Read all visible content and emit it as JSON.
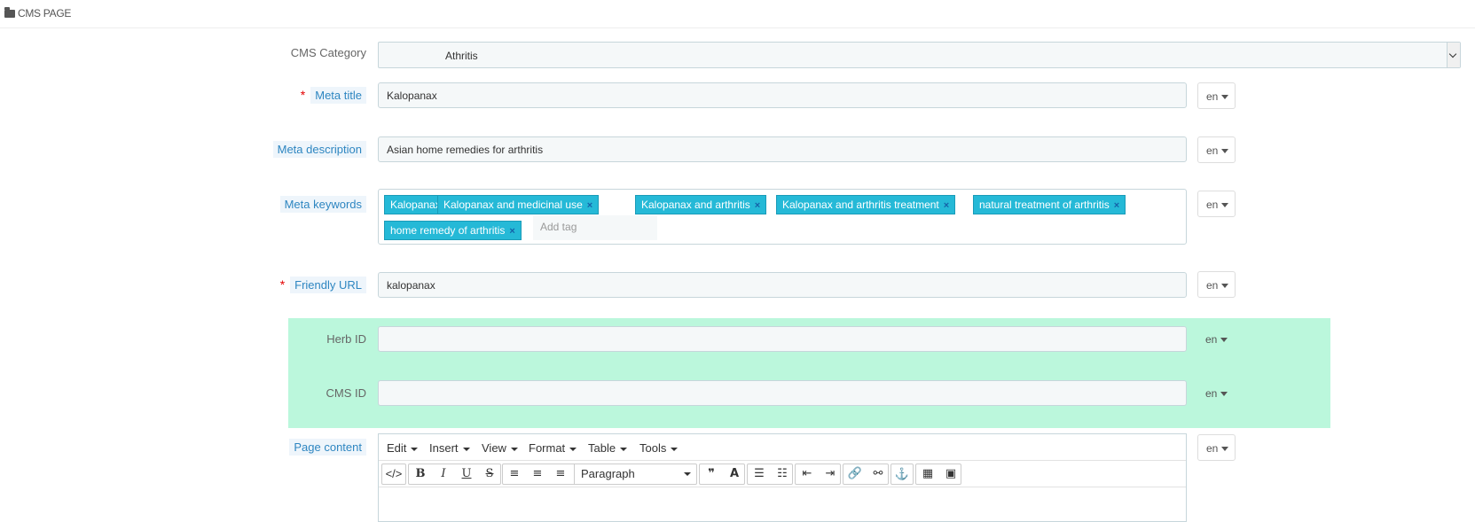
{
  "header": {
    "title": "CMS PAGE",
    "icon": "folder-icon"
  },
  "fields": {
    "cms_category": {
      "label": "CMS Category",
      "value": "Athritis"
    },
    "meta_title": {
      "label": "Meta title",
      "value": "Kalopanax",
      "lang": "en"
    },
    "meta_description": {
      "label": "Meta description",
      "value": "Asian home remedies for arthritis",
      "lang": "en"
    },
    "meta_keywords": {
      "label": "Meta keywords",
      "lang": "en",
      "tags": [
        "Kalopanax",
        "Kalopanax and medicinal use",
        "Kalopanax and arthritis",
        "Kalopanax and arthritis treatment",
        "natural treatment of arthritis",
        "home remedy of arthritis"
      ],
      "tag_remove": "×",
      "add_tag_placeholder": "Add tag"
    },
    "friendly_url": {
      "label": "Friendly URL",
      "value": "kalopanax",
      "lang": "en"
    },
    "herb_id": {
      "label": "Herb ID",
      "value": "",
      "lang": "en"
    },
    "cms_id": {
      "label": "CMS ID",
      "value": "",
      "lang": "en"
    },
    "page_content": {
      "label": "Page content",
      "lang": "en"
    }
  },
  "required_marker": "*",
  "editor": {
    "menus": [
      "Edit",
      "Insert",
      "View",
      "Format",
      "Table",
      "Tools"
    ],
    "format_select": "Paragraph"
  },
  "colors": {
    "tag_bg": "#25b9d7",
    "highlight_bg": "#bbf7dc",
    "required": "#e30000"
  }
}
